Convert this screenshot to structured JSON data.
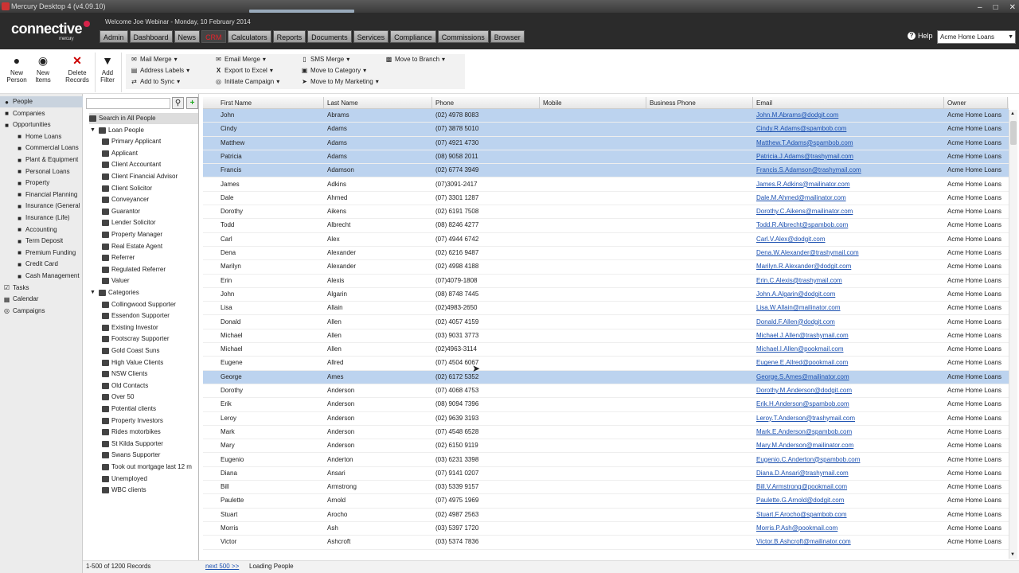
{
  "window": {
    "title": "Mercury Desktop 4 (v4.09.10)"
  },
  "header": {
    "logo_text": "connective",
    "logo_sub": "mercury",
    "welcome": "Welcome Joe Webinar - Monday, 10 February 2014",
    "tabs": [
      "Admin",
      "Dashboard",
      "News",
      "CRM",
      "Calculators",
      "Reports",
      "Documents",
      "Services",
      "Compliance",
      "Commissions",
      "Browser"
    ],
    "active_tab": "CRM",
    "help": "Help",
    "org": "Acme Home Loans"
  },
  "toolbar": {
    "new_person": "New Person",
    "new_items": "New Items",
    "delete_records": "Delete Records",
    "add_filter": "Add Filter",
    "mail_merge": "Mail Merge",
    "address_labels": "Address Labels",
    "add_to_sync": "Add to Sync",
    "email_merge": "Email Merge",
    "export_to_excel": "Export to Excel",
    "initiate_campaign": "Initiate Campaign",
    "sms_merge": "SMS Merge",
    "move_to_category": "Move to Category",
    "move_to_my_marketing": "Move to My Marketing",
    "move_to_branch": "Move to Branch"
  },
  "left_nav": [
    {
      "label": "People",
      "level": 0,
      "selected": true
    },
    {
      "label": "Companies",
      "level": 0
    },
    {
      "label": "Opportunities",
      "level": 0
    },
    {
      "label": "Home Loans",
      "level": 1
    },
    {
      "label": "Commercial Loans",
      "level": 1
    },
    {
      "label": "Plant & Equipment",
      "level": 1
    },
    {
      "label": "Personal Loans",
      "level": 1
    },
    {
      "label": "Property",
      "level": 1
    },
    {
      "label": "Financial Planning",
      "level": 1
    },
    {
      "label": "Insurance (General",
      "level": 1
    },
    {
      "label": "Insurance (Life)",
      "level": 1
    },
    {
      "label": "Accounting",
      "level": 1
    },
    {
      "label": "Term Deposit",
      "level": 1
    },
    {
      "label": "Premium Funding",
      "level": 1
    },
    {
      "label": "Credit Card",
      "level": 1
    },
    {
      "label": "Cash Management",
      "level": 1
    },
    {
      "label": "Tasks",
      "level": 0
    },
    {
      "label": "Calendar",
      "level": 0
    },
    {
      "label": "Campaigns",
      "level": 0
    }
  ],
  "mid_tree": [
    {
      "label": "Search in All People",
      "level": 0,
      "hl": true
    },
    {
      "label": "Loan People",
      "level": 1,
      "group": true
    },
    {
      "label": "Primary Applicant",
      "level": 2
    },
    {
      "label": "Applicant",
      "level": 2
    },
    {
      "label": "Client Accountant",
      "level": 2
    },
    {
      "label": "Client Financial Advisor",
      "level": 2
    },
    {
      "label": "Client Solicitor",
      "level": 2
    },
    {
      "label": "Conveyancer",
      "level": 2
    },
    {
      "label": "Guarantor",
      "level": 2
    },
    {
      "label": "Lender Solicitor",
      "level": 2
    },
    {
      "label": "Property Manager",
      "level": 2
    },
    {
      "label": "Real Estate Agent",
      "level": 2
    },
    {
      "label": "Referrer",
      "level": 2
    },
    {
      "label": "Regulated Referrer",
      "level": 2
    },
    {
      "label": "Valuer",
      "level": 2
    },
    {
      "label": "Categories",
      "level": 1,
      "group": true
    },
    {
      "label": "Collingwood Supporter",
      "level": 2
    },
    {
      "label": "Essendon Supporter",
      "level": 2
    },
    {
      "label": "Existing Investor",
      "level": 2
    },
    {
      "label": "Footscray Supporter",
      "level": 2
    },
    {
      "label": "Gold Coast Suns",
      "level": 2
    },
    {
      "label": "High Value Clients",
      "level": 2
    },
    {
      "label": "NSW Clients",
      "level": 2
    },
    {
      "label": "Old Contacts",
      "level": 2
    },
    {
      "label": "Over 50",
      "level": 2
    },
    {
      "label": "Potential clients",
      "level": 2
    },
    {
      "label": "Property Investors",
      "level": 2
    },
    {
      "label": "Rides motorbikes",
      "level": 2
    },
    {
      "label": "St Kilda Supporter",
      "level": 2
    },
    {
      "label": "Swans Supporter",
      "level": 2
    },
    {
      "label": "Took out mortgage last 12 m",
      "level": 2
    },
    {
      "label": "Unemployed",
      "level": 2
    },
    {
      "label": "WBC clients",
      "level": 2
    }
  ],
  "grid": {
    "columns": [
      "First Name",
      "Last Name",
      "Phone",
      "Mobile",
      "Business Phone",
      "Email",
      "Owner"
    ],
    "rows": [
      {
        "first": "John",
        "last": "Abrams",
        "phone": "(02) 4978 8083",
        "email": "John.M.Abrams@dodgit.com",
        "owner": "Acme Home Loans",
        "sel": true
      },
      {
        "first": "Cindy",
        "last": "Adams",
        "phone": "(07) 3878 5010",
        "email": "Cindy.R.Adams@spambob.com",
        "owner": "Acme Home Loans",
        "sel": true
      },
      {
        "first": "Matthew",
        "last": "Adams",
        "phone": "(07) 4921 4730",
        "email": "Matthew.T.Adams@spambob.com",
        "owner": "Acme Home Loans",
        "sel": true
      },
      {
        "first": "Patricia",
        "last": "Adams",
        "phone": "(08) 9058 2011",
        "email": "Patricia.J.Adams@trashymail.com",
        "owner": "Acme Home Loans",
        "sel": true
      },
      {
        "first": "Francis",
        "last": "Adamson",
        "phone": "(02) 6774 3949",
        "email": "Francis.S.Adamson@trashymail.com",
        "owner": "Acme Home Loans",
        "sel": true
      },
      {
        "first": "James",
        "last": "Adkins",
        "phone": "(07)3091-2417",
        "email": "James.R.Adkins@mailinator.com",
        "owner": "Acme Home Loans"
      },
      {
        "first": "Dale",
        "last": "Ahmed",
        "phone": "(07) 3301 1287",
        "email": "Dale.M.Ahmed@mailinator.com",
        "owner": "Acme Home Loans"
      },
      {
        "first": "Dorothy",
        "last": "Aikens",
        "phone": "(02) 6191 7508",
        "email": "Dorothy.C.Aikens@mailinator.com",
        "owner": "Acme Home Loans"
      },
      {
        "first": "Todd",
        "last": "Albrecht",
        "phone": "(08) 8246 4277",
        "email": "Todd.R.Albrecht@spambob.com",
        "owner": "Acme Home Loans"
      },
      {
        "first": "Carl",
        "last": "Alex",
        "phone": "(07) 4944 6742",
        "email": "Carl.V.Alex@dodgit.com",
        "owner": "Acme Home Loans"
      },
      {
        "first": "Dena",
        "last": "Alexander",
        "phone": "(02) 6216 9487",
        "email": "Dena.W.Alexander@trashymail.com",
        "owner": "Acme Home Loans"
      },
      {
        "first": "Marilyn",
        "last": "Alexander",
        "phone": "(02) 4998 4188",
        "email": "Marilyn.R.Alexander@dodgit.com",
        "owner": "Acme Home Loans"
      },
      {
        "first": "Erin",
        "last": "Alexis",
        "phone": "(07)4079-1808",
        "email": "Erin.C.Alexis@trashymail.com",
        "owner": "Acme Home Loans"
      },
      {
        "first": "John",
        "last": "Algarin",
        "phone": "(08) 8748 7445",
        "email": "John.A.Algarin@dodgit.com",
        "owner": "Acme Home Loans"
      },
      {
        "first": "Lisa",
        "last": "Allain",
        "phone": "(02)4983-2650",
        "email": "Lisa.W.Allain@mailinator.com",
        "owner": "Acme Home Loans"
      },
      {
        "first": "Donald",
        "last": "Allen",
        "phone": "(02) 4057 4159",
        "email": "Donald.F.Allen@dodgit.com",
        "owner": "Acme Home Loans"
      },
      {
        "first": "Michael",
        "last": "Allen",
        "phone": "(03) 9031 3773",
        "email": "Michael.J.Allen@trashymail.com",
        "owner": "Acme Home Loans"
      },
      {
        "first": "Michael",
        "last": "Allen",
        "phone": "(02)4963-3114",
        "email": "Michael.I.Allen@pookmail.com",
        "owner": "Acme Home Loans"
      },
      {
        "first": "Eugene",
        "last": "Allred",
        "phone": "(07) 4504 6067",
        "email": "Eugene.E.Allred@pookmail.com",
        "owner": "Acme Home Loans"
      },
      {
        "first": "George",
        "last": "Ames",
        "phone": "(02) 6172 5352",
        "email": "George.S.Ames@mailinator.com",
        "owner": "Acme Home Loans",
        "sel": true
      },
      {
        "first": "Dorothy",
        "last": "Anderson",
        "phone": "(07) 4068 4753",
        "email": "Dorothy.M.Anderson@dodgit.com",
        "owner": "Acme Home Loans"
      },
      {
        "first": "Erik",
        "last": "Anderson",
        "phone": "(08) 9094 7396",
        "email": "Erik.H.Anderson@spambob.com",
        "owner": "Acme Home Loans"
      },
      {
        "first": "Leroy",
        "last": "Anderson",
        "phone": "(02) 9639 3193",
        "email": "Leroy.T.Anderson@trashymail.com",
        "owner": "Acme Home Loans"
      },
      {
        "first": "Mark",
        "last": "Anderson",
        "phone": "(07) 4548 6528",
        "email": "Mark.E.Anderson@spambob.com",
        "owner": "Acme Home Loans"
      },
      {
        "first": "Mary",
        "last": "Anderson",
        "phone": "(02) 6150 9119",
        "email": "Mary.M.Anderson@mailinator.com",
        "owner": "Acme Home Loans"
      },
      {
        "first": "Eugenio",
        "last": "Anderton",
        "phone": "(03) 6231 3398",
        "email": "Eugenio.C.Anderton@spambob.com",
        "owner": "Acme Home Loans"
      },
      {
        "first": "Diana",
        "last": "Ansari",
        "phone": "(07) 9141 0207",
        "email": "Diana.D.Ansari@trashymail.com",
        "owner": "Acme Home Loans"
      },
      {
        "first": "Bill",
        "last": "Armstrong",
        "phone": "(03) 5339 9157",
        "email": "Bill.V.Armstrong@pookmail.com",
        "owner": "Acme Home Loans"
      },
      {
        "first": "Paulette",
        "last": "Arnold",
        "phone": "(07) 4975 1969",
        "email": "Paulette.G.Arnold@dodgit.com",
        "owner": "Acme Home Loans"
      },
      {
        "first": "Stuart",
        "last": "Arocho",
        "phone": "(02) 4987 2563",
        "email": "Stuart.F.Arocho@spambob.com",
        "owner": "Acme Home Loans"
      },
      {
        "first": "Morris",
        "last": "Ash",
        "phone": "(03) 5397 1720",
        "email": "Morris.P.Ash@pookmail.com",
        "owner": "Acme Home Loans"
      },
      {
        "first": "Victor",
        "last": "Ashcroft",
        "phone": "(03) 5374 7836",
        "email": "Victor.B.Ashcroft@mailinator.com",
        "owner": "Acme Home Loans"
      }
    ]
  },
  "status": {
    "records": "1-500 of 1200 Records",
    "next": "next 500 >>",
    "loading": "Loading People"
  }
}
